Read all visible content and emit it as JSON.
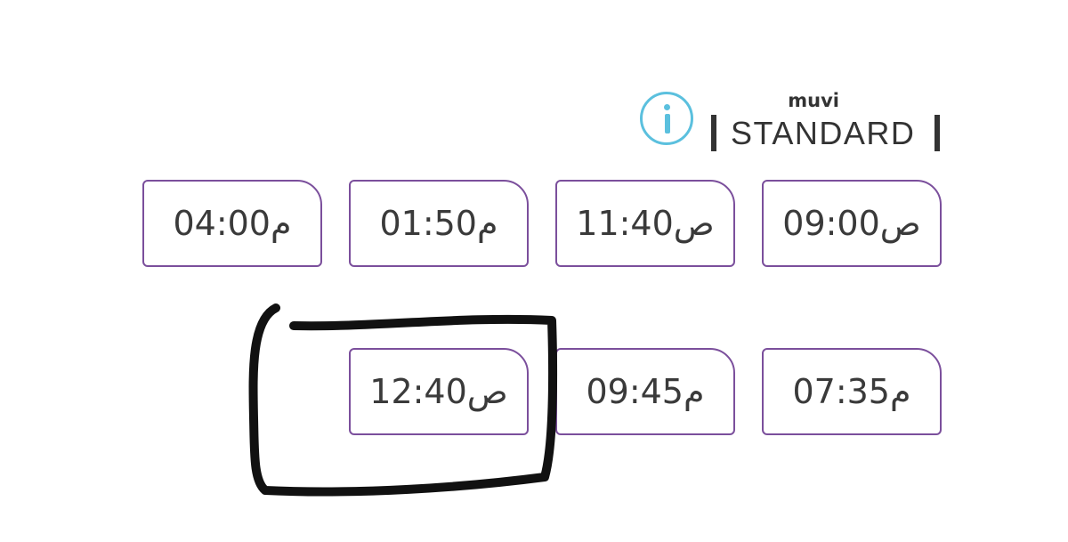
{
  "colors": {
    "slot_border": "#7b4f9c",
    "info_icon": "#5bc0de",
    "text": "#3a3a3a",
    "annotation": "#111111"
  },
  "header": {
    "info_icon_name": "info-icon",
    "brand_sub": "muvi",
    "brand_title": "STANDARD"
  },
  "showtimes": [
    {
      "label": "09:00ص"
    },
    {
      "label": "11:40ص"
    },
    {
      "label": "01:50م"
    },
    {
      "label": "04:00م"
    },
    {
      "label": "07:35م"
    },
    {
      "label": "09:45م"
    },
    {
      "label": "12:40ص"
    }
  ]
}
